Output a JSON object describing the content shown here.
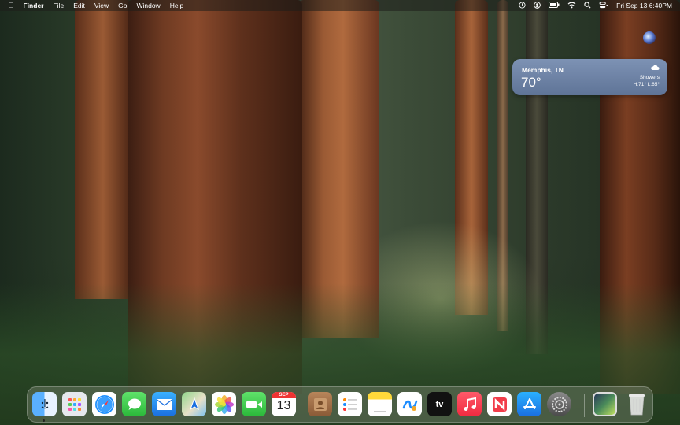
{
  "menubar": {
    "apple_icon": "apple-icon",
    "app_name": "Finder",
    "menus": [
      "File",
      "Edit",
      "View",
      "Go",
      "Window",
      "Help"
    ],
    "status_icons": [
      "time-machine-icon",
      "user-icon",
      "battery-icon",
      "wifi-icon",
      "search-icon",
      "control-center-icon"
    ],
    "clock": "Fri Sep 13  6:40PM"
  },
  "weather": {
    "city": "Memphis, TN",
    "temperature": "70°",
    "condition": "Showers",
    "high_low": "H:71° L:65°",
    "icon": "cloud-rain-icon"
  },
  "dock": {
    "apps": [
      "Finder",
      "Launchpad",
      "Safari",
      "Messages",
      "Mail",
      "Maps",
      "Photos",
      "FaceTime",
      "Calendar",
      "Contacts",
      "Reminders",
      "Notes",
      "Freeform",
      "TV",
      "Music",
      "News",
      "App Store",
      "System Settings",
      "Downloads",
      "Trash"
    ],
    "calendar_month": "SEP",
    "calendar_day": "13",
    "tv_label": "tv"
  },
  "colors": {
    "accent": "#0a84ff",
    "widget_bg": "#6e83a6",
    "calendar_red": "#e33333"
  }
}
